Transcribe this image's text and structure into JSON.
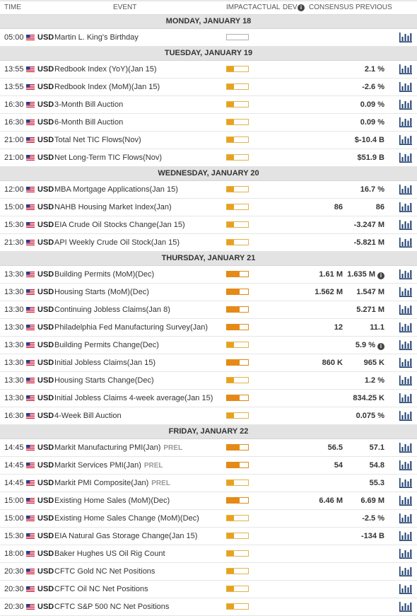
{
  "header": {
    "time": "TIME",
    "event": "EVENT",
    "impact": "IMPACT",
    "actual": "ACTUAL",
    "dev": "DEV",
    "info_icon": "info-icon",
    "consensus": "CONSENSUS",
    "previous": "PREVIOUS"
  },
  "colors": {
    "impact_high": "#e58a17",
    "impact_medium": "#e8a11e",
    "day_header_bg": "#e3e3e3",
    "chart_icon": "#1b3d6e"
  },
  "days": [
    {
      "label": "MONDAY, JANUARY 18",
      "events": [
        {
          "time": "05:00",
          "currency": "USD",
          "name": "Martin L. King's Birthday",
          "impact": 0,
          "consensus": "",
          "previous": ""
        }
      ]
    },
    {
      "label": "TUESDAY, JANUARY 19",
      "events": [
        {
          "time": "13:55",
          "currency": "USD",
          "name": "Redbook Index (YoY)(Jan 15)",
          "impact": 1,
          "consensus": "",
          "previous": "2.1 %"
        },
        {
          "time": "13:55",
          "currency": "USD",
          "name": "Redbook Index (MoM)(Jan 15)",
          "impact": 1,
          "consensus": "",
          "previous": "-2.6 %"
        },
        {
          "time": "16:30",
          "currency": "USD",
          "name": "3-Month Bill Auction",
          "impact": 1,
          "consensus": "",
          "previous": "0.09 %"
        },
        {
          "time": "16:30",
          "currency": "USD",
          "name": "6-Month Bill Auction",
          "impact": 1,
          "consensus": "",
          "previous": "0.09 %"
        },
        {
          "time": "21:00",
          "currency": "USD",
          "name": "Total Net TIC Flows(Nov)",
          "impact": 1,
          "consensus": "",
          "previous": "$-10.4 B"
        },
        {
          "time": "21:00",
          "currency": "USD",
          "name": "Net Long-Term TIC Flows(Nov)",
          "impact": 1,
          "consensus": "",
          "previous": "$51.9 B"
        }
      ]
    },
    {
      "label": "WEDNESDAY, JANUARY 20",
      "events": [
        {
          "time": "12:00",
          "currency": "USD",
          "name": "MBA Mortgage Applications(Jan 15)",
          "impact": 1,
          "consensus": "",
          "previous": "16.7 %"
        },
        {
          "time": "15:00",
          "currency": "USD",
          "name": "NAHB Housing Market Index(Jan)",
          "impact": 1,
          "consensus": "86",
          "previous": "86"
        },
        {
          "time": "15:30",
          "currency": "USD",
          "name": "EIA Crude Oil Stocks Change(Jan 15)",
          "impact": 1,
          "consensus": "",
          "previous": "-3.247 M"
        },
        {
          "time": "21:30",
          "currency": "USD",
          "name": "API Weekly Crude Oil Stock(Jan 15)",
          "impact": 1,
          "consensus": "",
          "previous": "-5.821 M"
        }
      ]
    },
    {
      "label": "THURSDAY, JANUARY 21",
      "events": [
        {
          "time": "13:30",
          "currency": "USD",
          "name": "Building Permits (MoM)(Dec)",
          "impact": 2,
          "consensus": "1.61 M",
          "previous": "1.635 M",
          "previous_info": true
        },
        {
          "time": "13:30",
          "currency": "USD",
          "name": "Housing Starts (MoM)(Dec)",
          "impact": 2,
          "consensus": "1.562 M",
          "previous": "1.547 M"
        },
        {
          "time": "13:30",
          "currency": "USD",
          "name": "Continuing Jobless Claims(Jan 8)",
          "impact": 2,
          "consensus": "",
          "previous": "5.271 M"
        },
        {
          "time": "13:30",
          "currency": "USD",
          "name": "Philadelphia Fed Manufacturing Survey(Jan)",
          "impact": 2,
          "consensus": "12",
          "previous": "11.1"
        },
        {
          "time": "13:30",
          "currency": "USD",
          "name": "Building Permits Change(Dec)",
          "impact": 1,
          "consensus": "",
          "previous": "5.9 %",
          "previous_info": true
        },
        {
          "time": "13:30",
          "currency": "USD",
          "name": "Initial Jobless Claims(Jan 15)",
          "impact": 2,
          "consensus": "860 K",
          "previous": "965 K"
        },
        {
          "time": "13:30",
          "currency": "USD",
          "name": "Housing Starts Change(Dec)",
          "impact": 1,
          "consensus": "",
          "previous": "1.2 %"
        },
        {
          "time": "13:30",
          "currency": "USD",
          "name": "Initial Jobless Claims 4-week average(Jan 15)",
          "impact": 2,
          "consensus": "",
          "previous": "834.25 K"
        },
        {
          "time": "16:30",
          "currency": "USD",
          "name": "4-Week Bill Auction",
          "impact": 1,
          "consensus": "",
          "previous": "0.075 %"
        }
      ]
    },
    {
      "label": "FRIDAY, JANUARY 22",
      "events": [
        {
          "time": "14:45",
          "currency": "USD",
          "name": "Markit Manufacturing PMI(Jan)",
          "prel": "PREL",
          "impact": 2,
          "consensus": "56.5",
          "previous": "57.1"
        },
        {
          "time": "14:45",
          "currency": "USD",
          "name": "Markit Services PMI(Jan)",
          "prel": "PREL",
          "impact": 2,
          "consensus": "54",
          "previous": "54.8"
        },
        {
          "time": "14:45",
          "currency": "USD",
          "name": "Markit PMI Composite(Jan)",
          "prel": "PREL",
          "impact": 1,
          "consensus": "",
          "previous": "55.3"
        },
        {
          "time": "15:00",
          "currency": "USD",
          "name": "Existing Home Sales (MoM)(Dec)",
          "impact": 2,
          "consensus": "6.46 M",
          "previous": "6.69 M"
        },
        {
          "time": "15:00",
          "currency": "USD",
          "name": "Existing Home Sales Change (MoM)(Dec)",
          "impact": 1,
          "consensus": "",
          "previous": "-2.5 %"
        },
        {
          "time": "15:30",
          "currency": "USD",
          "name": "EIA Natural Gas Storage Change(Jan 15)",
          "impact": 1,
          "consensus": "",
          "previous": "-134 B"
        },
        {
          "time": "18:00",
          "currency": "USD",
          "name": "Baker Hughes US Oil Rig Count",
          "impact": 1,
          "consensus": "",
          "previous": ""
        },
        {
          "time": "20:30",
          "currency": "USD",
          "name": "CFTC Gold NC Net Positions",
          "impact": 1,
          "consensus": "",
          "previous": ""
        },
        {
          "time": "20:30",
          "currency": "USD",
          "name": "CFTC Oil NC Net Positions",
          "impact": 1,
          "consensus": "",
          "previous": ""
        },
        {
          "time": "20:30",
          "currency": "USD",
          "name": "CFTC S&P 500 NC Net Positions",
          "impact": 1,
          "consensus": "",
          "previous": ""
        }
      ]
    }
  ]
}
